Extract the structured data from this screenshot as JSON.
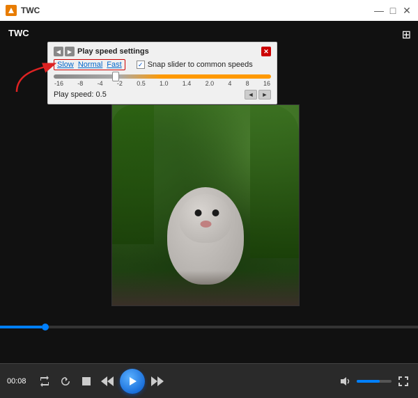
{
  "window": {
    "title": "TWC",
    "app_icon": "play-icon"
  },
  "title_bar": {
    "minimize_label": "—",
    "maximize_label": "□",
    "close_label": "✕"
  },
  "play_speed_panel": {
    "title": "Play speed settings",
    "nav_back": "◀",
    "nav_forward": "▶",
    "close": "✕",
    "speed_slow": "Slow",
    "speed_normal": "Normal",
    "speed_fast": "Fast",
    "snap_label": "Snap slider to common speeds",
    "snap_checked": true,
    "slider_labels": [
      "-16",
      "-8",
      "-4",
      "-2",
      "0.5",
      "1.0",
      "1.4",
      "2.0",
      "4",
      "8",
      "16"
    ],
    "play_speed_label": "Play speed:",
    "play_speed_value": "0.5",
    "step_back": "◄",
    "step_fwd": "►"
  },
  "controls": {
    "time_display": "00:08",
    "btn_repeat": "↺",
    "btn_refresh": "↻",
    "btn_stop": "■",
    "btn_rew": "◄◄",
    "btn_play": "▶",
    "btn_fwd": "►►",
    "btn_volume": "🔊",
    "btn_fullscreen": "⛶"
  },
  "colors": {
    "accent": "#0080ff",
    "panel_bg": "#f0f0f0",
    "highlight_red": "#cc0000",
    "player_bg": "#111111"
  }
}
